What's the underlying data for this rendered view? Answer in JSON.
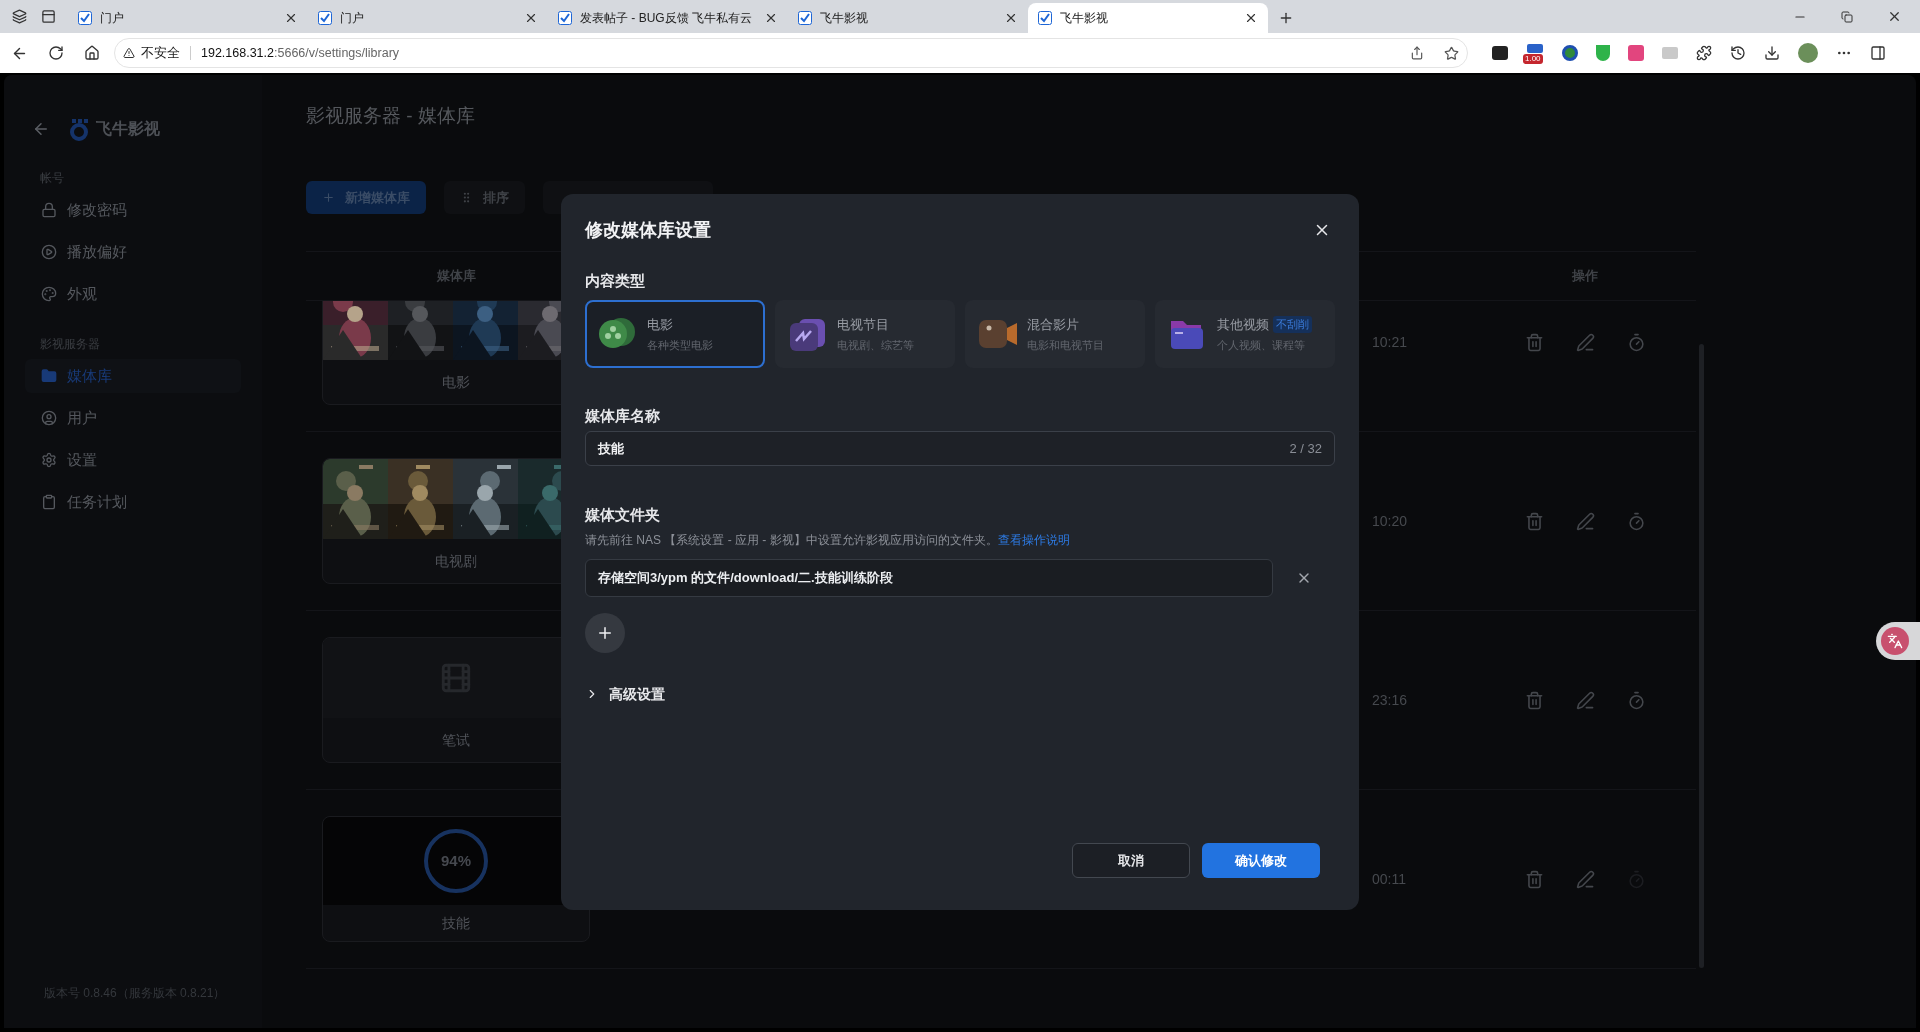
{
  "browser": {
    "tabs": [
      {
        "title": "门户",
        "selected": false
      },
      {
        "title": "门户",
        "selected": false
      },
      {
        "title": "发表帖子 - BUG反馈 飞牛私有云",
        "selected": false
      },
      {
        "title": "飞牛影视",
        "selected": false
      },
      {
        "title": "飞牛影视",
        "selected": true
      }
    ],
    "address": {
      "security": "不安全",
      "host": "192.168.31.2",
      "path": ":5666/v/settings/library"
    },
    "extension_badge": "1.00"
  },
  "sidebar": {
    "app_name": "飞牛影视",
    "sections": [
      {
        "label": "帐号",
        "items": [
          {
            "label": "修改密码",
            "selected": false
          },
          {
            "label": "播放偏好",
            "selected": false
          },
          {
            "label": "外观",
            "selected": false
          }
        ]
      },
      {
        "label": "影视服务器",
        "items": [
          {
            "label": "媒体库",
            "selected": true
          },
          {
            "label": "用户",
            "selected": false
          },
          {
            "label": "设置",
            "selected": false
          },
          {
            "label": "任务计划",
            "selected": false
          }
        ]
      }
    ],
    "version": "版本号 0.8.46（服务版本 0.8.21）"
  },
  "page_title": "影视服务器 - 媒体库",
  "toolbar": [
    {
      "kind": "primary",
      "label": "新增媒体库"
    },
    {
      "kind": "sort",
      "label": "排序"
    },
    {
      "kind": "scan"
    }
  ],
  "table": {
    "columns": [
      "媒体库",
      "操作"
    ],
    "rows": [
      {
        "name": "电影",
        "cover": {
          "kind": "posters"
        },
        "time": "10:21",
        "scan_disabled": false
      },
      {
        "name": "电视剧",
        "cover": {
          "kind": "posters"
        },
        "time": "10:20",
        "scan_disabled": false
      },
      {
        "name": "笔试",
        "cover": {
          "kind": "empty"
        },
        "time": "23:16",
        "scan_disabled": false
      },
      {
        "name": "技能",
        "cover": {
          "kind": "progress",
          "label": "94%"
        },
        "time": "00:11",
        "scan_disabled": true
      }
    ]
  },
  "dialog": {
    "title": "修改媒体库设置",
    "content_type": {
      "label": "内容类型",
      "options": [
        {
          "title": "电影",
          "subtitle": "各种类型电影",
          "selected": true
        },
        {
          "title": "电视节目",
          "subtitle": "电视剧、综艺等",
          "selected": false
        },
        {
          "title": "混合影片",
          "subtitle": "电影和电视节目",
          "selected": false
        },
        {
          "title": "其他视频",
          "badge": "不刮削",
          "subtitle": "个人视频、课程等",
          "selected": false
        }
      ]
    },
    "name": {
      "label": "媒体库名称",
      "value": "技能",
      "counter": "2 / 32"
    },
    "folders": {
      "label": "媒体文件夹",
      "hint": "请先前往 NAS 【系统设置 - 应用 - 影视】中设置允许影视应用访问的文件夹。",
      "link": "查看操作说明",
      "paths": [
        "存储空间3/ypm 的文件/download/二.技能训练阶段"
      ]
    },
    "advanced": {
      "label": "高级设置",
      "expanded": false
    },
    "buttons": {
      "cancel": "取消",
      "confirm": "确认修改"
    }
  }
}
